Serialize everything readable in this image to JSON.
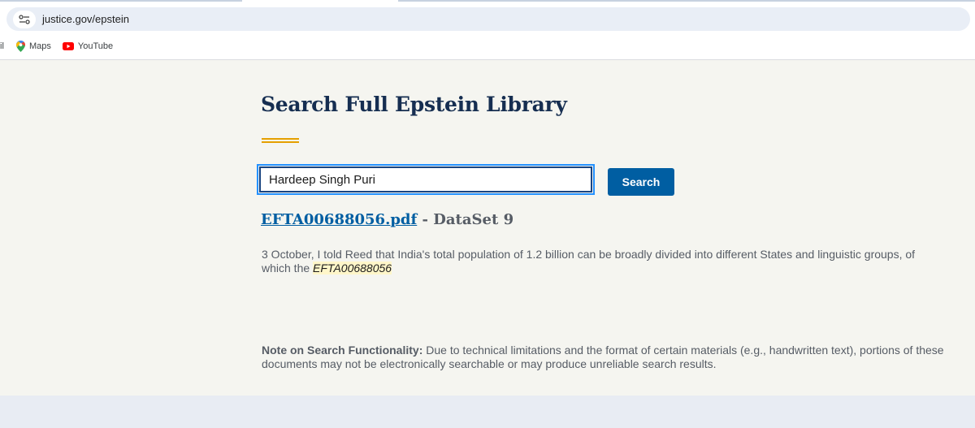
{
  "browser": {
    "url": "justice.gov/epstein",
    "bookmarks": {
      "clipped_label": "il",
      "items": [
        {
          "label": "Maps",
          "icon": "maps-pin-icon"
        },
        {
          "label": "YouTube",
          "icon": "youtube-icon"
        }
      ]
    }
  },
  "page": {
    "title": "Search Full Epstein Library",
    "search": {
      "value": "Hardeep Singh Puri",
      "button_label": "Search"
    },
    "result": {
      "file_name": "EFTA00688056.pdf",
      "separator": " - ",
      "dataset": "DataSet 9",
      "snippet_text": "3 October, I told Reed that India's total population of 1.2 billion can be broadly divided into different States and linguistic groups, of which the ",
      "snippet_highlight": "EFTA00688056"
    },
    "note": {
      "label": "Note on Search Functionality:",
      "text": " Due to technical limitations and the format of certain materials (e.g., handwritten text), portions of these documents may not be electronically searchable or may produce unreliable search results."
    }
  },
  "colors": {
    "heading": "#162e51",
    "accent_rule": "#e5a000",
    "button": "#005ea2",
    "link": "#005ea2",
    "highlight": "#fff6c9",
    "page_bg": "#f5f5f0"
  }
}
